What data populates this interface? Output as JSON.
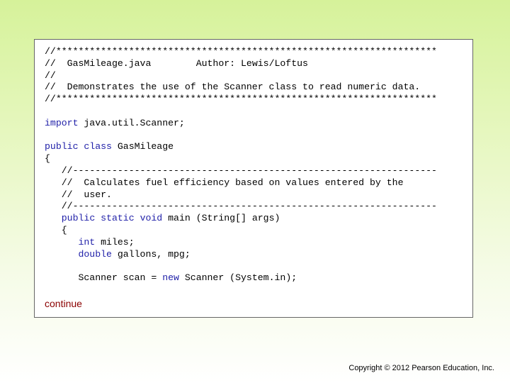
{
  "code": {
    "header_stars": "//********************************************************************",
    "header_title_prefix": "//  ",
    "header_file": "GasMileage.java",
    "header_author": "Author: Lewis/Loftus",
    "header_blank": "//",
    "header_description": "//  Demonstrates the use of the Scanner class to read numeric data.",
    "import_keyword": "import",
    "import_rest": " java.util.Scanner;",
    "public_kw": "public",
    "class_kw": "class",
    "class_name": " GasMileage",
    "open_brace": "{",
    "method_dashes": "//-----------------------------------------------------------------",
    "method_comment_1": "//  Calculates fuel efficiency based on values entered by the",
    "method_comment_2": "//  user.",
    "static_kw": "static",
    "void_kw": "void",
    "method_sig_rest": " main (String[] args)",
    "int_kw": "int",
    "int_rest": " miles;",
    "double_kw": "double",
    "double_rest": " gallons, mpg;",
    "scanner_decl": "Scanner scan = ",
    "new_kw": "new",
    "scanner_rest": " Scanner (System.in);"
  },
  "continue_label": "continue",
  "copyright": "Copyright © 2012 Pearson Education, Inc.",
  "colors": {
    "keyword": "#1f1fa8",
    "continue": "#8b0000"
  }
}
